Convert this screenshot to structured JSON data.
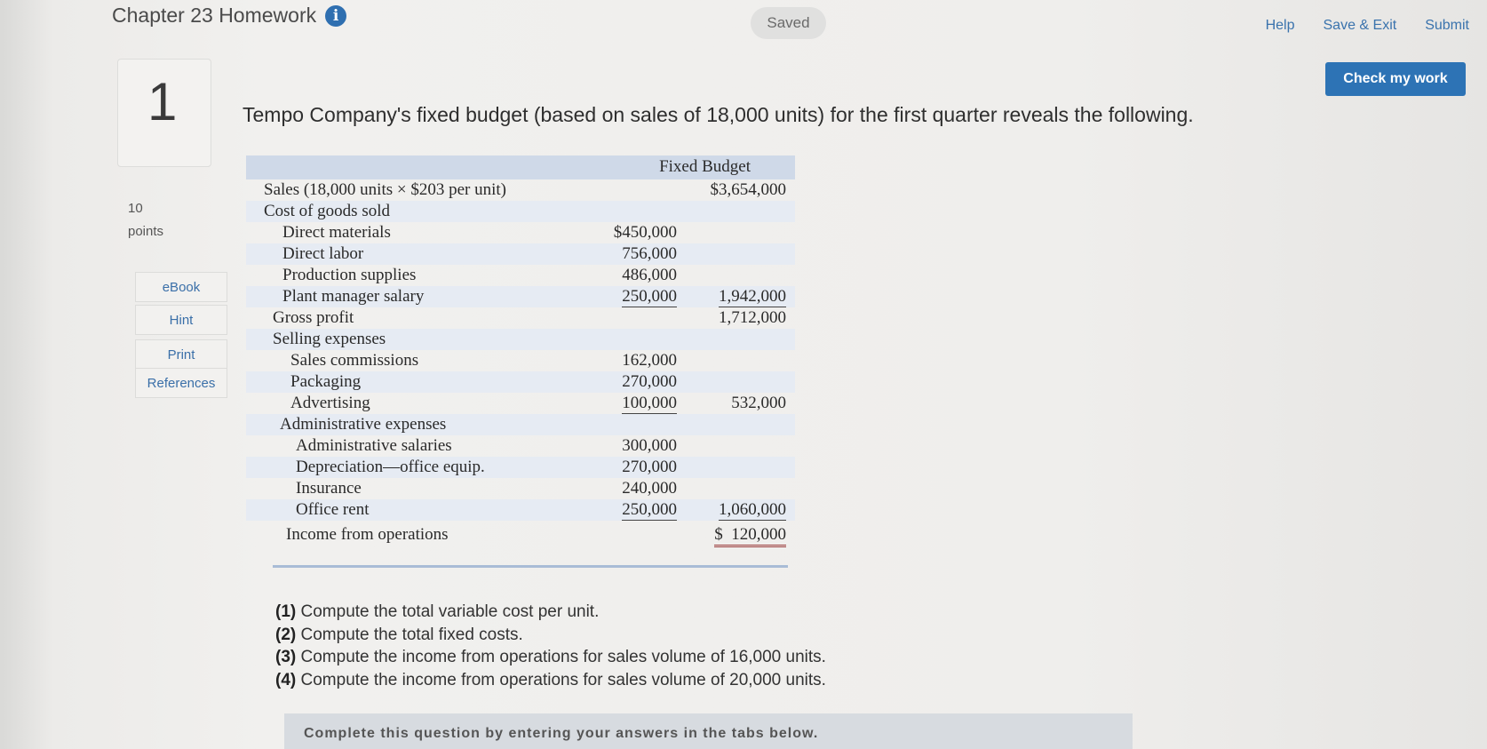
{
  "header": {
    "title": "Chapter 23 Homework",
    "saved_label": "Saved",
    "links": {
      "help": "Help",
      "save_exit": "Save & Exit",
      "submit": "Submit"
    }
  },
  "check_button": "Check my work",
  "question_number": "1",
  "points": {
    "value": "10",
    "label": "points"
  },
  "side_buttons": {
    "ebook": "eBook",
    "hint": "Hint",
    "print": "Print",
    "references": "References"
  },
  "question_text": "Tempo Company's fixed budget (based on sales of 18,000 units) for the first quarter reveals the following.",
  "budget": {
    "header": "Fixed Budget",
    "rows": [
      {
        "label": "Sales (18,000 units × $203 per unit)",
        "c1": "",
        "c2": "$3,654,000"
      },
      {
        "label": "Cost of goods sold",
        "c1": "",
        "c2": ""
      },
      {
        "label": "Direct materials",
        "c1": "$450,000",
        "c2": ""
      },
      {
        "label": "Direct labor",
        "c1": "756,000",
        "c2": ""
      },
      {
        "label": "Production supplies",
        "c1": "486,000",
        "c2": ""
      },
      {
        "label": "Plant manager salary",
        "c1": "250,000",
        "c2": "1,942,000"
      },
      {
        "label": "Gross profit",
        "c1": "",
        "c2": "1,712,000"
      },
      {
        "label": "Selling expenses",
        "c1": "",
        "c2": ""
      },
      {
        "label": "Sales commissions",
        "c1": "162,000",
        "c2": ""
      },
      {
        "label": "Packaging",
        "c1": "270,000",
        "c2": ""
      },
      {
        "label": "Advertising",
        "c1": "100,000",
        "c2": "532,000"
      },
      {
        "label": "Administrative expenses",
        "c1": "",
        "c2": ""
      },
      {
        "label": "Administrative salaries",
        "c1": "300,000",
        "c2": ""
      },
      {
        "label": "Depreciation—office equip.",
        "c1": "270,000",
        "c2": ""
      },
      {
        "label": "Insurance",
        "c1": "240,000",
        "c2": ""
      },
      {
        "label": "Office rent",
        "c1": "250,000",
        "c2": "1,060,000"
      },
      {
        "label": "Income from operations",
        "c1": "",
        "c2": "$  120,000"
      }
    ]
  },
  "tasks": [
    {
      "num": "(1)",
      "text": "Compute the total variable cost per unit."
    },
    {
      "num": "(2)",
      "text": "Compute the total fixed costs."
    },
    {
      "num": "(3)",
      "text": "Compute the income from operations for sales volume of 16,000 units."
    },
    {
      "num": "(4)",
      "text": "Compute the income from operations for sales volume of 20,000 units."
    }
  ],
  "complete_instruction": "Complete this question by entering your answers in the tabs below."
}
